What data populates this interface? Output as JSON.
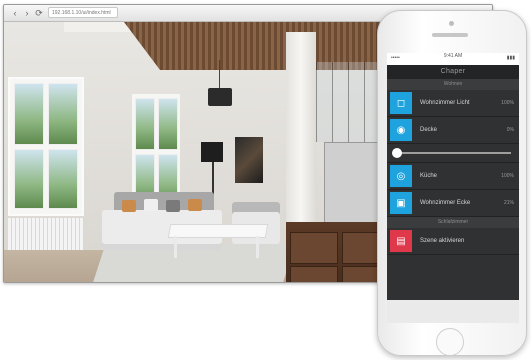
{
  "browser": {
    "address": "192.168.1.10/ui/index.html",
    "nav": {
      "back": "‹",
      "forward": "›",
      "reload": "⟳"
    }
  },
  "phone": {
    "status": {
      "carrier": "•••••",
      "time": "9:41 AM",
      "battery": "▮▮▮"
    },
    "app_title": "Chaper",
    "sections": [
      {
        "label": "Wohnen"
      },
      {
        "label": "Schlafzimmer"
      }
    ],
    "rows": [
      {
        "icon": "light-icon",
        "label": "Wohnzimmer Licht",
        "value": "100%"
      },
      {
        "icon": "lamp-icon",
        "label": "Decke",
        "value": "0%"
      },
      {
        "icon": "bulb-icon",
        "label": "Küche",
        "value": "100%"
      },
      {
        "icon": "plug-icon",
        "label": "Wohnzimmer Ecke",
        "value": "21%"
      }
    ],
    "slider": {
      "value": 0.02
    },
    "scene_row": {
      "icon": "scene-icon",
      "label": "Szene aktivieren"
    },
    "colors": {
      "accent": "#1fa3df",
      "alert": "#e0384b",
      "screen_bg": "#2f3132"
    }
  }
}
